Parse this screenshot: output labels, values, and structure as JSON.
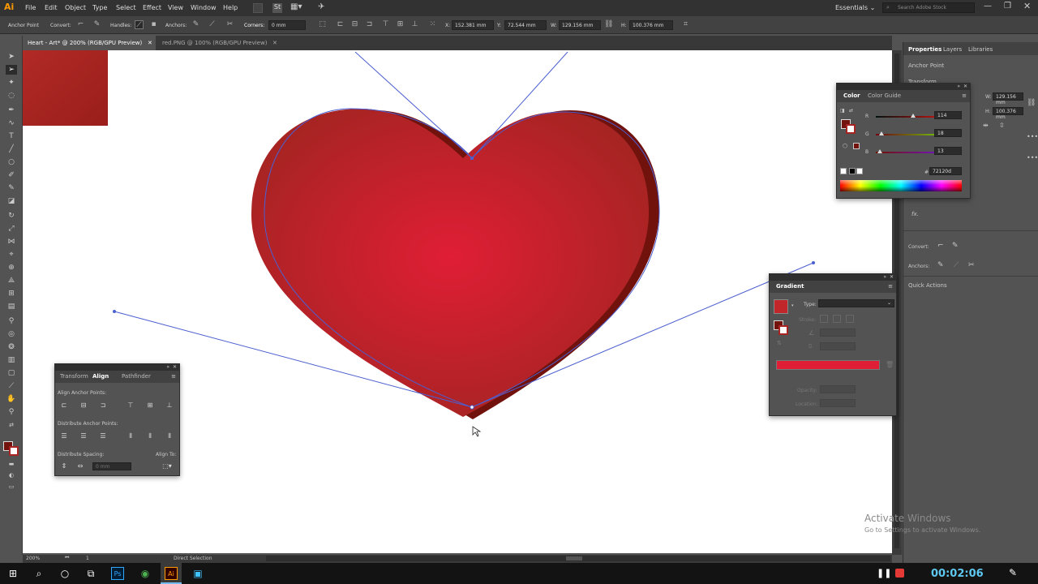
{
  "app": {
    "logo": "Ai"
  },
  "menu": [
    "File",
    "Edit",
    "Object",
    "Type",
    "Select",
    "Effect",
    "View",
    "Window",
    "Help"
  ],
  "workspace": {
    "label": "Essentials",
    "search_placeholder": "Search Adobe Stock"
  },
  "control_bar": {
    "mode": "Anchor Point",
    "convert": "Convert:",
    "handles": "Handles:",
    "anchors": "Anchors:",
    "corners": "Corners:",
    "corner_value": "0 mm",
    "x_label": "X:",
    "x_value": "152.381 mm",
    "y_label": "Y:",
    "y_value": "72.544 mm",
    "w_label": "W:",
    "w_value": "129.156 mm",
    "h_label": "H:",
    "h_value": "100.376 mm"
  },
  "tabs": [
    {
      "label": "Heart - Art* @ 200% (RGB/GPU Preview)",
      "active": true
    },
    {
      "label": "red.PNG @ 100% (RGB/GPU Preview)",
      "active": false
    }
  ],
  "properties": {
    "tabs": [
      "Properties",
      "Layers",
      "Libraries"
    ],
    "section": "Anchor Point",
    "section2": "Transform",
    "w_label": "W:",
    "w_value": "129.156 mm",
    "h_label": "H:",
    "h_value": "100.376 mm",
    "fx": "fx.",
    "convert": "Convert:",
    "anchors": "Anchors:",
    "quick_actions": "Quick Actions"
  },
  "color_panel": {
    "tabs": [
      "Color",
      "Color Guide"
    ],
    "r_label": "R",
    "r_value": "114",
    "g_label": "G",
    "g_value": "18",
    "b_label": "B",
    "b_value": "13",
    "hex_prefix": "#",
    "hex": "72120d",
    "r_level": 0.447,
    "g_level": 0.071,
    "b_level": 0.051
  },
  "gradient_panel": {
    "title": "Gradient",
    "type_label": "Type:",
    "stroke_label": "Stroke:",
    "opacity_label": "Opacity:",
    "location_label": "Location:"
  },
  "align_panel": {
    "tabs": [
      "Transform",
      "Align",
      "Pathfinder"
    ],
    "align_anchor": "Align Anchor Points:",
    "distribute_anchor": "Distribute Anchor Points:",
    "distribute_spacing": "Distribute Spacing:",
    "spacing_value": "0 mm",
    "align_to": "Align To:"
  },
  "status": {
    "zoom": "200%",
    "page": "1",
    "tool": "Direct Selection"
  },
  "watermark": {
    "title": "Activate Windows",
    "subtitle": "Go to Settings to activate Windows."
  },
  "taskbar": {
    "timer": "00:02:06",
    "apps": [
      "Ps",
      "Ai"
    ]
  },
  "colors": {
    "heart_center": "#e01e35",
    "heart_edge": "#a52422",
    "heart_side": "#72120d",
    "swatch": "#a82422",
    "path": "#4b5fd0",
    "accent": "#1e90d8"
  }
}
